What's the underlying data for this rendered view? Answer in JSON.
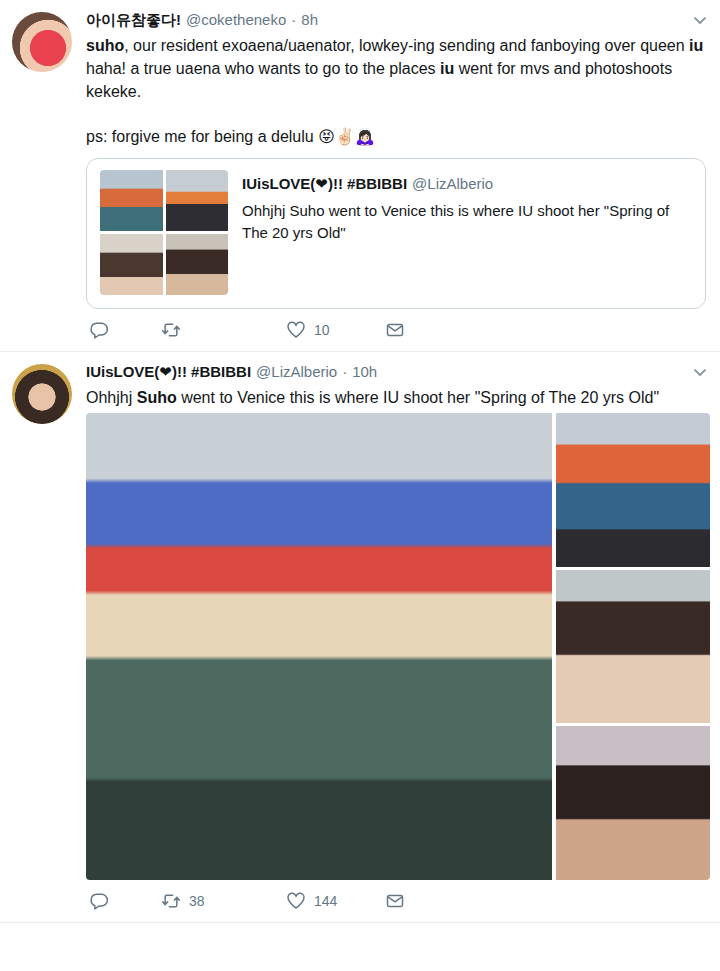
{
  "tweets": [
    {
      "kind": "quote",
      "name": "아이유참좋다!",
      "handle": "@coketheneko",
      "separator": "·",
      "time": "8h",
      "paragraphs": [
        [
          {
            "text": "suho",
            "bold": true
          },
          {
            "text": ", our resident exoaena/uaenator, lowkey-ing sending and fanboying over queen ",
            "bold": false
          },
          {
            "text": "iu",
            "bold": true
          },
          {
            "text": " haha! a true uaena who wants to go to the places ",
            "bold": false
          },
          {
            "text": "iu",
            "bold": true
          },
          {
            "text": " went for mvs and photoshoots kekeke.",
            "bold": false
          }
        ],
        [
          {
            "text": "ps: forgive me for being a delulu 😝✌🏻🙇🏻‍♀️",
            "bold": false
          }
        ]
      ],
      "quote": {
        "name": "IUisLOVE(❤)!! #BBIBBI",
        "handle": "@LizAlberio",
        "text": "Ohhjhj Suho went to Venice this is where IU shoot her \"Spring of The 20 yrs Old\""
      },
      "actions": [
        {
          "kind": "reply"
        },
        {
          "kind": "retweet"
        },
        {
          "kind": "like",
          "count": "10"
        },
        {
          "kind": "dm"
        }
      ]
    },
    {
      "kind": "gallery",
      "name": "IUisLOVE(❤)!! #BBIBBI",
      "handle": "@LizAlberio",
      "separator": "·",
      "time": "10h",
      "paragraphs": [
        [
          {
            "text": "Ohhjhj ",
            "bold": false
          },
          {
            "text": "Suho",
            "bold": true
          },
          {
            "text": " went to Venice this is where IU shoot her \"Spring of The 20 yrs Old\"",
            "bold": false
          }
        ]
      ],
      "actions": [
        {
          "kind": "reply"
        },
        {
          "kind": "retweet",
          "count": "38"
        },
        {
          "kind": "like",
          "count": "144"
        },
        {
          "kind": "dm"
        }
      ]
    }
  ]
}
